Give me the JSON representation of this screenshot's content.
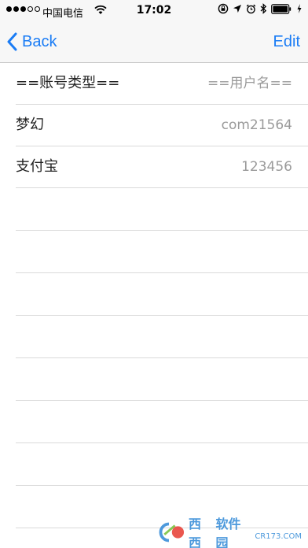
{
  "status_bar": {
    "carrier": "中国电信",
    "time": "17:02"
  },
  "nav": {
    "back_label": "Back",
    "edit_label": "Edit"
  },
  "header_row": {
    "type_label": "==账号类型==",
    "user_label": "==用户名=="
  },
  "accounts": [
    {
      "type": "梦幻",
      "username": "com21564"
    },
    {
      "type": "支付宝",
      "username": "123456"
    }
  ],
  "watermark": {
    "logo_text": "西西",
    "name": "软件园",
    "site": "CR173.COM"
  },
  "colors": {
    "accent": "#1a7cf5",
    "separator": "#dadada",
    "secondary_text": "#9a9a9a"
  }
}
